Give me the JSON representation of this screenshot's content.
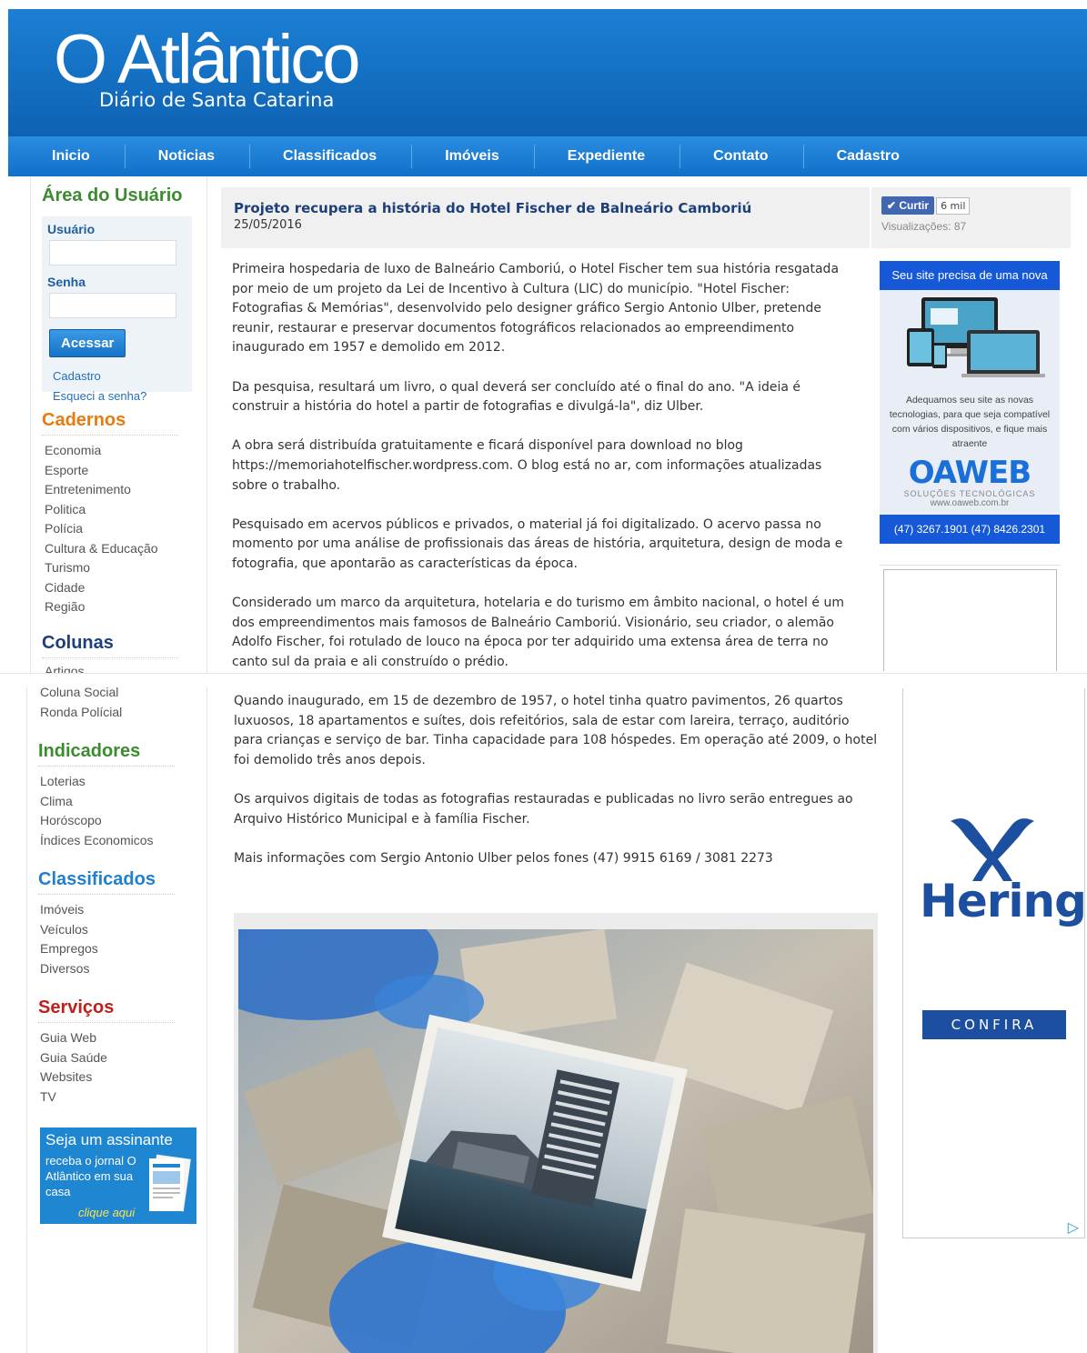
{
  "header": {
    "title": "O Atlântico",
    "subtitle": "Diário de Santa Catarina"
  },
  "nav": {
    "items": [
      "Inicio",
      "Noticias",
      "Classificados",
      "Imóveis",
      "Expediente",
      "Contato",
      "Cadastro"
    ]
  },
  "user_area": {
    "heading": "Área do Usuário",
    "username_label": "Usuário",
    "password_label": "Senha",
    "login_button": "Acessar",
    "register_link": "Cadastro",
    "forgot_link": "Esqueci a senha?"
  },
  "cadernos": {
    "heading": "Cadernos",
    "items": [
      "Economia",
      "Esporte",
      "Entretenimento",
      "Politica",
      "Polícia",
      "Cultura & Educação",
      "Turismo",
      "Cidade",
      "Região"
    ]
  },
  "colunas": {
    "heading": "Colunas",
    "items_top": [
      "Artigos"
    ],
    "items": [
      "Coluna Social",
      "Ronda Polícial"
    ]
  },
  "indicadores": {
    "heading": "Indicadores",
    "items": [
      "Loterias",
      "Clima",
      "Horóscopo",
      "Índices Economicos"
    ]
  },
  "classificados": {
    "heading": "Classificados",
    "items": [
      "Imóveis",
      "Veículos",
      "Empregos",
      "Diversos"
    ]
  },
  "servicos": {
    "heading": "Serviços",
    "items": [
      "Guia Web",
      "Guia Saúde",
      "Websites",
      "TV"
    ]
  },
  "subscribe_ad": {
    "line1": "Seja um assinante",
    "line2": "receba o jornal O Atlântico em sua casa",
    "cta": "clique aqui"
  },
  "article": {
    "title": "Projeto recupera a história do Hotel Fischer de Balneário Camboriú",
    "date": "25/05/2016",
    "like_label": "Curtir",
    "like_count": "6 mil",
    "views": "Visualizações: 87",
    "paragraphs_top": [
      "Primeira hospedaria de luxo de Balneário Camboriú, o Hotel Fischer tem sua história resgatada por meio de um projeto da Lei de Incentivo à Cultura (LIC) do município. \"Hotel Fischer: Fotografias & Memórias\", desenvolvido pelo designer gráfico Sergio Antonio Ulber, pretende reunir, restaurar e preservar documentos fotográficos relacionados ao empreendimento inaugurado em 1957 e demolido em 2012.",
      "Da pesquisa, resultará um livro, o qual deverá ser concluído até o final do ano. \"A ideia é construir a história do hotel a partir de fotografias e divulgá-la\", diz Ulber.",
      "A obra será distribuída gratuitamente e ficará disponível para download no blog https://memoriahotelfischer.wordpress.com. O blog está no ar, com informações atualizadas sobre o trabalho.",
      "Pesquisado em acervos públicos e privados, o material já foi digitalizado. O acervo passa no momento por uma análise de profissionais das áreas de história, arquitetura, design de moda e fotografia, que apontarão as características da época.",
      "Considerado um marco da arquitetura, hotelaria e do turismo em âmbito nacional, o hotel é um dos empreendimentos mais famosos de Balneário Camboriú. Visionário, seu criador, o alemão Adolfo Fischer, foi rotulado de louco na época por ter adquirido uma extensa área de terra no canto sul da praia e ali construído o prédio."
    ],
    "paragraphs_bottom": [
      "Quando inaugurado, em 15 de dezembro de 1957, o hotel tinha quatro pavimentos, 26 quartos luxuosos, 18 apartamentos e suítes, dois refeitórios, sala de estar com lareira, terraço, auditório para crianças e serviço de bar. Tinha capacidade para 108 hóspedes. Em operação até 2009, o hotel foi demolido três anos depois.",
      "Os arquivos digitais de todas as fotografias restauradas e publicadas no livro serão entregues ao Arquivo Histórico Municipal e à família Fischer.",
      "Mais informações com Sergio Antonio Ulber pelos fones (47) 9915 6169 / 3081 2273"
    ]
  },
  "oaweb_ad": {
    "headline": "Seu site precisa de uma nova cara?",
    "text": "Adequamos seu site as novas tecnologias, para que seja compatível com vários dispositivos, e fique mais atraente",
    "brand": "OAWEB",
    "tagline": "SOLUÇÕES TECNOLÓGICAS",
    "url": "www.oaweb.com.br",
    "phones": "(47) 3267.1901  (47) 8426.2301"
  },
  "hering_ad": {
    "brand": "Hering",
    "cta": "CONFIRA"
  },
  "colors": {
    "header_blue": "#1070c5",
    "nav_blue": "#1f80d6",
    "title_navy": "#1d3f7a"
  }
}
